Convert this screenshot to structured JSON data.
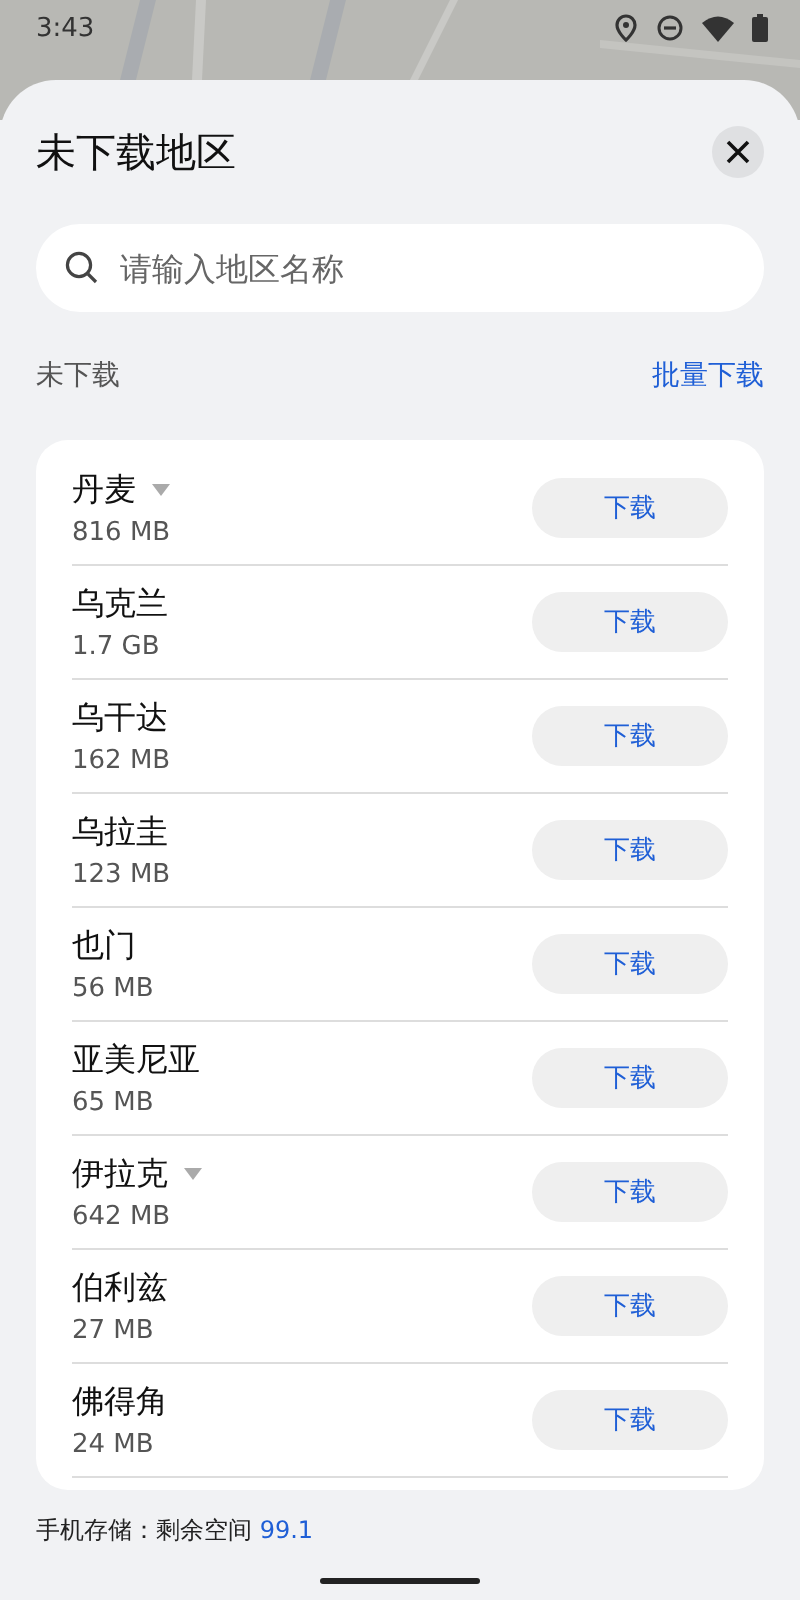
{
  "status_bar": {
    "time": "3:43"
  },
  "sheet": {
    "title": "未下载地区",
    "search": {
      "placeholder": "请输入地区名称"
    },
    "section_label": "未下载",
    "batch_action": "批量下载"
  },
  "regions": [
    {
      "name": "丹麦",
      "size": "816 MB",
      "expandable": true,
      "action": "下载"
    },
    {
      "name": "乌克兰",
      "size": "1.7 GB",
      "expandable": false,
      "action": "下载"
    },
    {
      "name": "乌干达",
      "size": "162 MB",
      "expandable": false,
      "action": "下载"
    },
    {
      "name": "乌拉圭",
      "size": "123 MB",
      "expandable": false,
      "action": "下载"
    },
    {
      "name": "也门",
      "size": "56 MB",
      "expandable": false,
      "action": "下载"
    },
    {
      "name": "亚美尼亚",
      "size": "65 MB",
      "expandable": false,
      "action": "下载"
    },
    {
      "name": "伊拉克",
      "size": "642 MB",
      "expandable": true,
      "action": "下载"
    },
    {
      "name": "伯利兹",
      "size": "27 MB",
      "expandable": false,
      "action": "下载"
    },
    {
      "name": "佛得角",
      "size": "24 MB",
      "expandable": false,
      "action": "下载"
    }
  ],
  "storage": {
    "label": "手机存储：剩余空间",
    "value": "99.1"
  }
}
